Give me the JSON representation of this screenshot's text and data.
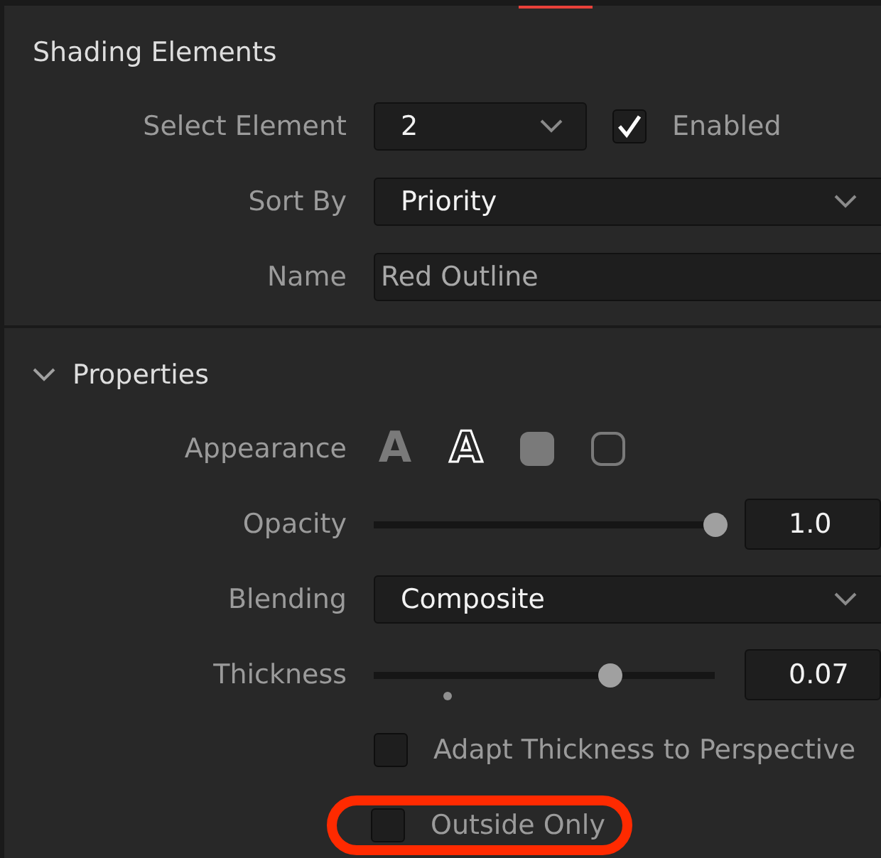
{
  "sections": [
    {
      "title": "Shading Elements",
      "rows": [
        {
          "kind": "dropdown",
          "label": "Select Element",
          "value": "2",
          "narrow": true,
          "check": {
            "label": "Enabled",
            "checked": true
          }
        },
        {
          "kind": "dropdown",
          "label": "Sort By",
          "value": "Priority",
          "narrow": false
        },
        {
          "kind": "text",
          "label": "Name",
          "value": "Red Outline"
        }
      ]
    },
    {
      "title": "Properties",
      "expanded": true,
      "rows": [
        {
          "kind": "appearance",
          "label": "Appearance",
          "options": [
            {
              "kind": "letter-solid",
              "glyph": "A",
              "selected": false
            },
            {
              "kind": "letter-outline",
              "glyph": "A",
              "selected": true
            },
            {
              "kind": "square-solid",
              "selected": false
            },
            {
              "kind": "square-outline",
              "selected": false
            }
          ]
        },
        {
          "kind": "slider",
          "label": "Opacity",
          "level": 1.0,
          "reading": "1.0",
          "default_mark": false
        },
        {
          "kind": "dropdown",
          "label": "Blending",
          "value": "Composite",
          "narrow": false
        },
        {
          "kind": "slider",
          "label": "Thickness",
          "level": 0.69,
          "reading": "0.07",
          "default_mark": true
        },
        {
          "kind": "checkbox",
          "label": "Adapt Thickness to Perspective",
          "checked": false,
          "highlighted": false
        },
        {
          "kind": "checkbox",
          "label": "Outside Only",
          "checked": false,
          "highlighted": true
        }
      ]
    }
  ]
}
